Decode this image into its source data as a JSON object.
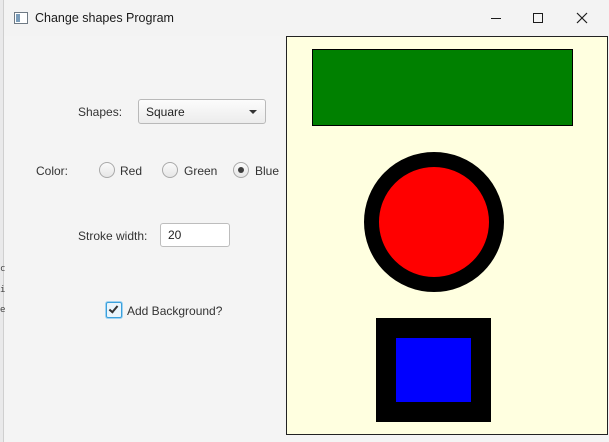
{
  "window": {
    "title": "Change shapes Program"
  },
  "controls": {
    "shapes_label": "Shapes:",
    "shape_selected": "Square",
    "color_label": "Color:",
    "color_options": [
      {
        "label": "Red",
        "checked": false
      },
      {
        "label": "Green",
        "checked": false
      },
      {
        "label": "Blue",
        "checked": true
      }
    ],
    "stroke_label": "Stroke width:",
    "stroke_value": "20",
    "background_label": "Add Background?",
    "background_checked": true
  },
  "canvas": {
    "background_color": "#ffffe0",
    "shapes": [
      {
        "type": "rectangle",
        "fill": "#008000",
        "stroke": "#000000"
      },
      {
        "type": "circle",
        "fill": "#ff0000",
        "stroke": "#000000"
      },
      {
        "type": "square",
        "fill": "#0000ff",
        "stroke": "#000000"
      }
    ]
  },
  "icons": {
    "app": "app-window-icon",
    "minimize": "minimize-icon",
    "maximize": "maximize-icon",
    "close": "close-icon",
    "dropdown": "chevron-down-icon",
    "check": "checkmark-icon"
  }
}
